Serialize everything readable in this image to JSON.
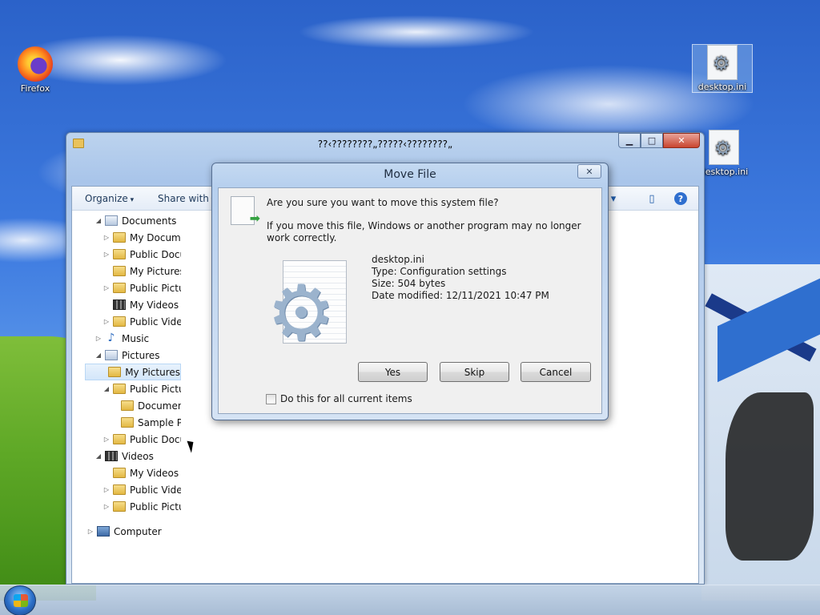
{
  "desktop": {
    "icons": [
      {
        "label": "Firefox",
        "icon": "firefox-icon"
      },
      {
        "label": "desktop.ini",
        "icon": "settings-file-icon"
      },
      {
        "label": "desktop.ini",
        "icon": "settings-file-icon"
      }
    ]
  },
  "explorer": {
    "title": "??‹????????„?????‹????????„",
    "toolbar": {
      "organize": "Organize",
      "share_with": "Share with"
    },
    "tree": [
      {
        "label": "Documents",
        "icon": "library-icon",
        "expander": "expanded"
      },
      {
        "label": "My Documents",
        "icon": "folder-icon",
        "expander": "collapsed"
      },
      {
        "label": "Public Documents",
        "icon": "folder-icon",
        "expander": "collapsed"
      },
      {
        "label": "My Pictures",
        "icon": "folder-icon",
        "expander": "none"
      },
      {
        "label": "Public Pictures",
        "icon": "folder-icon",
        "expander": "collapsed"
      },
      {
        "label": "My Videos",
        "icon": "video-folder-icon",
        "expander": "none"
      },
      {
        "label": "Public Videos",
        "icon": "folder-icon",
        "expander": "collapsed"
      },
      {
        "label": "Music",
        "icon": "music-icon",
        "expander": "collapsed"
      },
      {
        "label": "Pictures",
        "icon": "library-icon",
        "expander": "expanded"
      },
      {
        "label": "My Pictures",
        "icon": "folder-icon",
        "expander": "none",
        "selected": true
      },
      {
        "label": "Public Pictures",
        "icon": "folder-icon",
        "expander": "expanded"
      },
      {
        "label": "Documents",
        "icon": "folder-icon",
        "expander": "none"
      },
      {
        "label": "Sample Pictures",
        "icon": "folder-icon",
        "expander": "none"
      },
      {
        "label": "Public Documents",
        "icon": "folder-icon",
        "expander": "collapsed"
      },
      {
        "label": "Videos",
        "icon": "video-library-icon",
        "expander": "expanded"
      },
      {
        "label": "My Videos",
        "icon": "folder-icon",
        "expander": "none"
      },
      {
        "label": "Public Videos",
        "icon": "folder-icon",
        "expander": "collapsed"
      },
      {
        "label": "Public Pictures",
        "icon": "folder-icon",
        "expander": "collapsed"
      },
      {
        "label": "Computer",
        "icon": "computer-icon",
        "expander": "collapsed"
      }
    ]
  },
  "dialog": {
    "title": "Move File",
    "question": "Are you sure you want to move this system file?",
    "warning": "If you move this file, Windows or another program may no longer work correctly.",
    "file": {
      "name": "desktop.ini",
      "type": "Type: Configuration settings",
      "size": "Size: 504 bytes",
      "modified": "Date modified: 12/11/2021 10:47 PM"
    },
    "buttons": {
      "yes": "Yes",
      "skip": "Skip",
      "cancel": "Cancel"
    },
    "checkbox_label": "Do this for all current items",
    "checkbox_checked": false
  },
  "colors": {
    "desktop_sky": "#3e7be0",
    "dialog_frame": "#c4d9f1",
    "window_frame": "#bcd3ee"
  }
}
